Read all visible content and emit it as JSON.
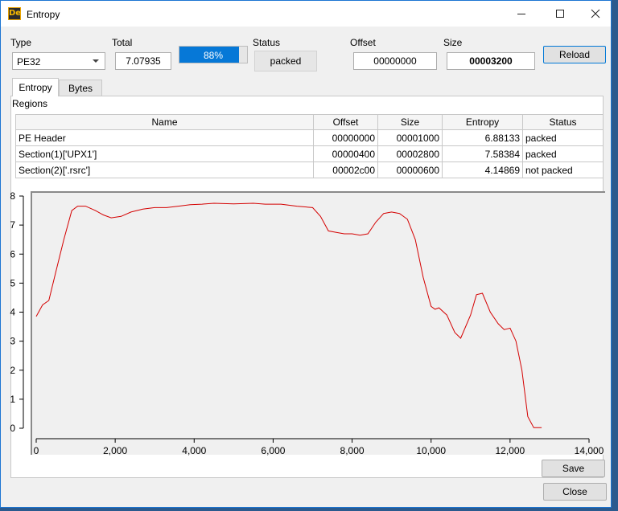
{
  "window": {
    "icon_text": "De",
    "title": "Entropy"
  },
  "top": {
    "type_label": "Type",
    "type_value": "PE32",
    "total_label": "Total",
    "total_value": "7.07935",
    "progress_text": "88%",
    "progress_value": 0.88,
    "status_label": "Status",
    "status_value": "packed",
    "offset_label": "Offset",
    "offset_value": "00000000",
    "size_label": "Size",
    "size_value": "00003200",
    "reload_label": "Reload"
  },
  "tabs": [
    {
      "label": "Entropy",
      "active": true
    },
    {
      "label": "Bytes",
      "active": false
    }
  ],
  "regions": {
    "label": "Regions",
    "columns": [
      "Name",
      "Offset",
      "Size",
      "Entropy",
      "Status"
    ],
    "rows": [
      {
        "name": "PE Header",
        "offset": "00000000",
        "size": "00001000",
        "entropy": "6.88133",
        "status": "packed"
      },
      {
        "name": "Section(1)['UPX1']",
        "offset": "00000400",
        "size": "00002800",
        "entropy": "7.58384",
        "status": "packed"
      },
      {
        "name": "Section(2)['.rsrc']",
        "offset": "00002c00",
        "size": "00000600",
        "entropy": "4.14869",
        "status": "not packed"
      }
    ]
  },
  "chart_data": {
    "type": "line",
    "title": "",
    "xlabel": "",
    "ylabel": "",
    "xlim": [
      0,
      14000
    ],
    "ylim": [
      0,
      8
    ],
    "x_ticks": [
      0,
      2000,
      4000,
      6000,
      8000,
      10000,
      12000,
      14000
    ],
    "x_tick_labels": [
      "0",
      "2,000",
      "4,000",
      "6,000",
      "8,000",
      "10,000",
      "12,000",
      "14,000"
    ],
    "y_ticks": [
      0,
      1,
      2,
      3,
      4,
      5,
      6,
      7,
      8
    ],
    "y_tick_labels": [
      "0",
      "1",
      "2",
      "3",
      "4",
      "5",
      "6",
      "7",
      "8"
    ],
    "grid": false,
    "line_color": "#d40000",
    "series": [
      {
        "x": [
          0,
          160,
          320,
          500,
          700,
          900,
          1050,
          1250,
          1500,
          1700,
          1900,
          2150,
          2400,
          2700,
          3000,
          3300,
          3600,
          3900,
          4200,
          4500,
          5000,
          5500,
          5800,
          6200,
          6600,
          7000,
          7200,
          7400,
          7600,
          7800,
          8000,
          8200,
          8400,
          8600,
          8800,
          9000,
          9200,
          9400,
          9600,
          9800,
          10000,
          10100,
          10200,
          10400,
          10600,
          10750,
          11000,
          11150,
          11300,
          11500,
          11700,
          11850,
          12000,
          12150,
          12300,
          12450,
          12600,
          12800
        ],
        "values": [
          3.85,
          4.25,
          4.4,
          5.4,
          6.5,
          7.5,
          7.65,
          7.65,
          7.5,
          7.35,
          7.25,
          7.3,
          7.45,
          7.55,
          7.6,
          7.6,
          7.65,
          7.7,
          7.72,
          7.75,
          7.73,
          7.75,
          7.72,
          7.72,
          7.65,
          7.6,
          7.3,
          6.8,
          6.75,
          6.7,
          6.7,
          6.65,
          6.7,
          7.1,
          7.4,
          7.45,
          7.4,
          7.2,
          6.5,
          5.2,
          4.2,
          4.1,
          4.15,
          3.9,
          3.3,
          3.1,
          3.9,
          4.6,
          4.65,
          4.0,
          3.6,
          3.4,
          3.45,
          3.0,
          2.0,
          0.4,
          0.02,
          0.02
        ]
      }
    ]
  },
  "buttons": {
    "save_label": "Save",
    "close_label": "Close"
  }
}
